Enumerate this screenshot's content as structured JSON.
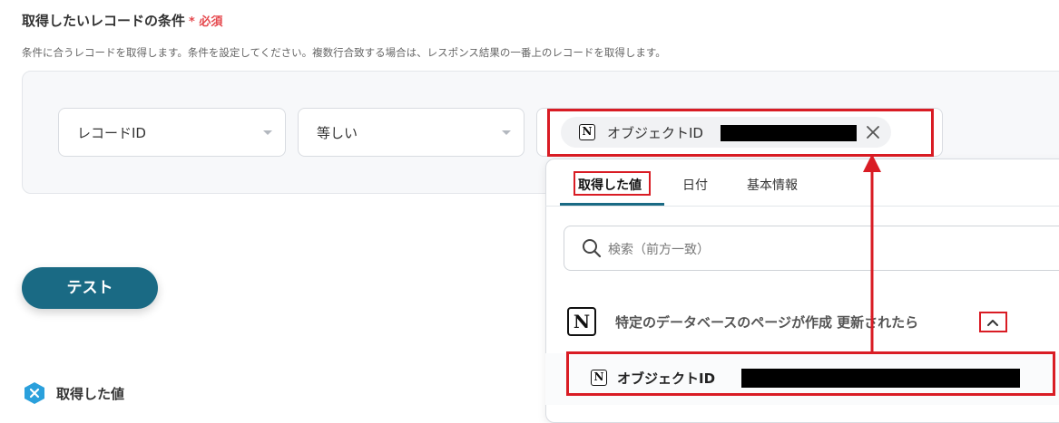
{
  "section": {
    "title": "取得したいレコードの条件",
    "required_mark": "*",
    "required_label": "必須",
    "description": "条件に合うレコードを取得します。条件を設定してください。複数行合致する場合は、レスポンス結果の一番上のレコードを取得します。"
  },
  "condition": {
    "field_select": "レコードID",
    "operator_select": "等しい",
    "value_chip_label": "オブジェクトID",
    "value_chip_icon": "notion-icon"
  },
  "test_button": "テスト",
  "dropdown": {
    "tabs": [
      "取得した値",
      "日付",
      "基本情報"
    ],
    "active_tab": 0,
    "search_placeholder": "検索（前方一致）",
    "group_label": "特定のデータベースのページが作成 更新されたら",
    "item_label": "オブジェクトID"
  },
  "bottom": {
    "title": "取得した値"
  },
  "colors": {
    "accent": "#1a6a84",
    "annotation_red": "#d91c24",
    "required_red": "#e5484d",
    "logo_blue": "#2aa0dc"
  }
}
